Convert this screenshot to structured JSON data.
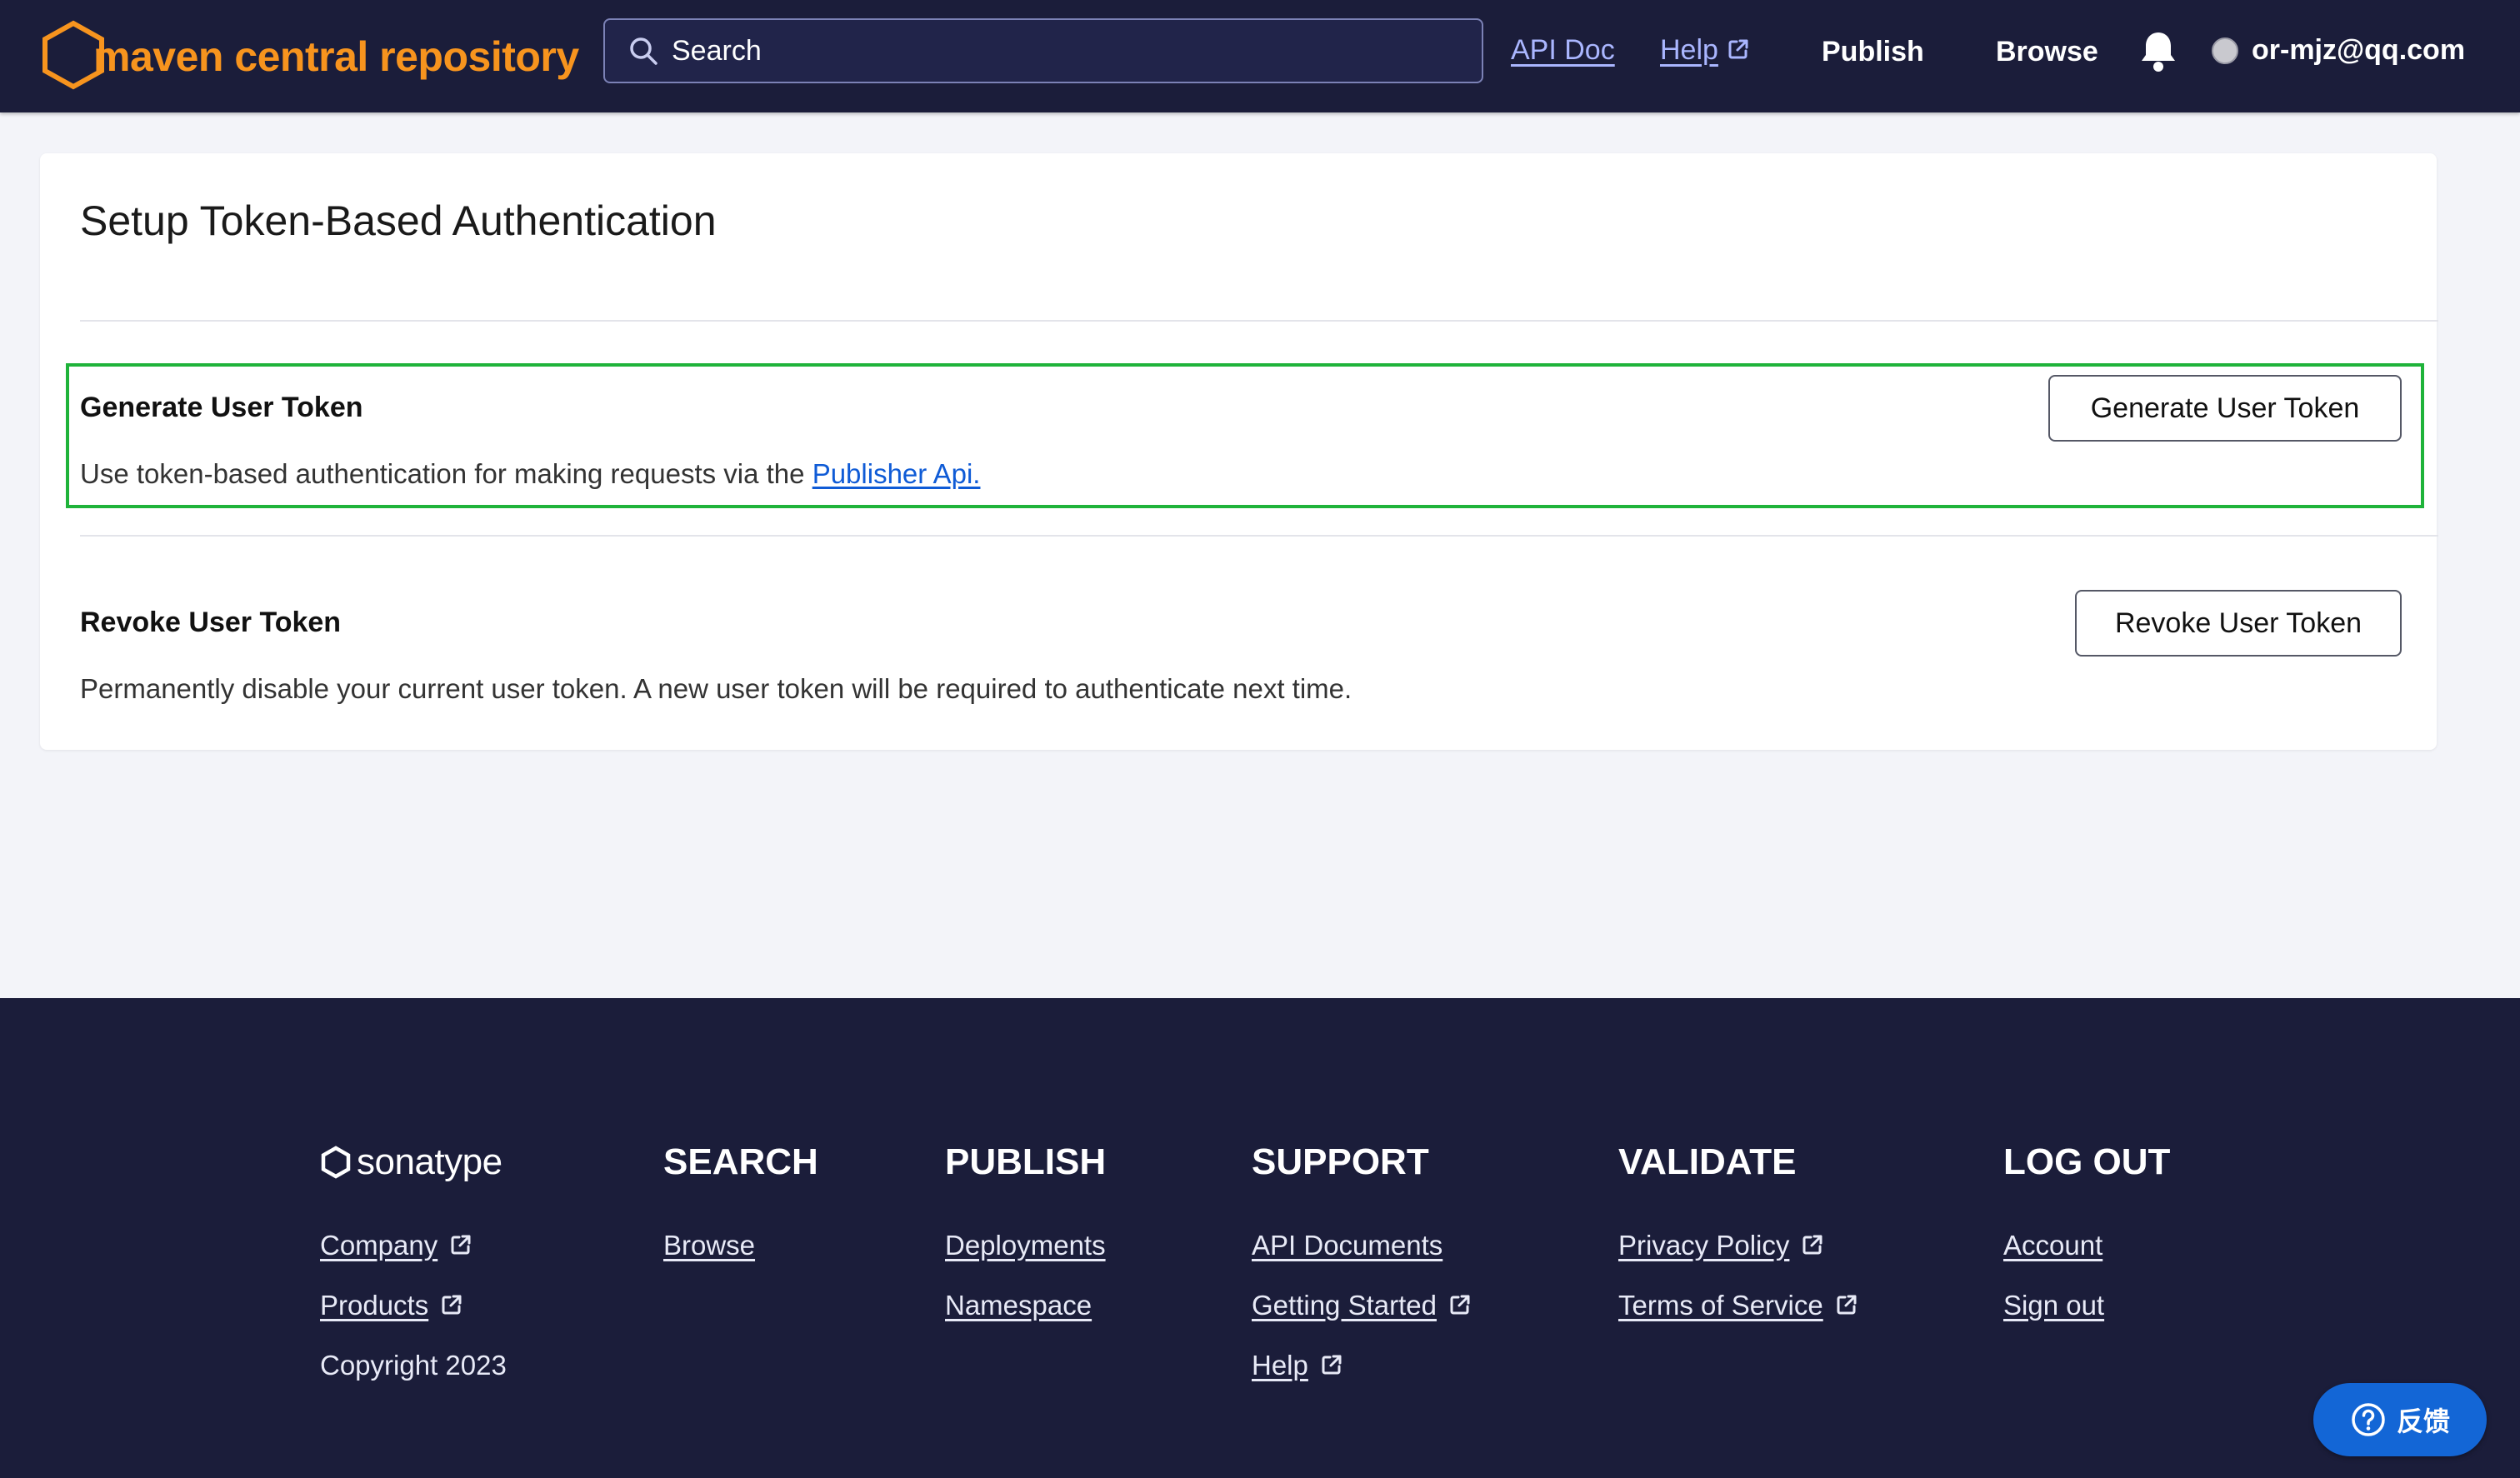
{
  "header": {
    "logo_text": "maven central repository",
    "search_placeholder": "Search",
    "api_doc": "API Doc",
    "help": "Help",
    "publish": "Publish",
    "browse": "Browse",
    "user": "or-mjz@qq.com"
  },
  "card": {
    "title": "Setup Token-Based Authentication",
    "generate": {
      "title": "Generate User Token",
      "desc_prefix": "Use token-based authentication for making requests via the ",
      "desc_link": "Publisher Api.",
      "button": "Generate User Token"
    },
    "revoke": {
      "title": "Revoke User Token",
      "desc": "Permanently disable your current user token. A new user token will be required to authenticate next time.",
      "button": "Revoke User Token"
    }
  },
  "footer": {
    "brand": "sonatype",
    "company": "Company",
    "products": "Products",
    "copyright": "Copyright 2023",
    "search_head": "SEARCH",
    "browse": "Browse",
    "publish_head": "PUBLISH",
    "deployments": "Deployments",
    "namespace": "Namespace",
    "support_head": "SUPPORT",
    "api_documents": "API Documents",
    "getting_started": "Getting Started",
    "help": "Help",
    "validate_head": "VALIDATE",
    "privacy": "Privacy Policy",
    "terms": "Terms of Service",
    "logout_head": "LOG OUT",
    "account": "Account",
    "sign_out": "Sign out"
  },
  "feedback": {
    "label": "反馈"
  },
  "colors": {
    "header_bg": "#1b1d3a",
    "brand_orange": "#f7941e",
    "link_blue": "#0f5bd6",
    "highlight_green": "#1fb33a",
    "feedback_blue": "#1366d6"
  }
}
